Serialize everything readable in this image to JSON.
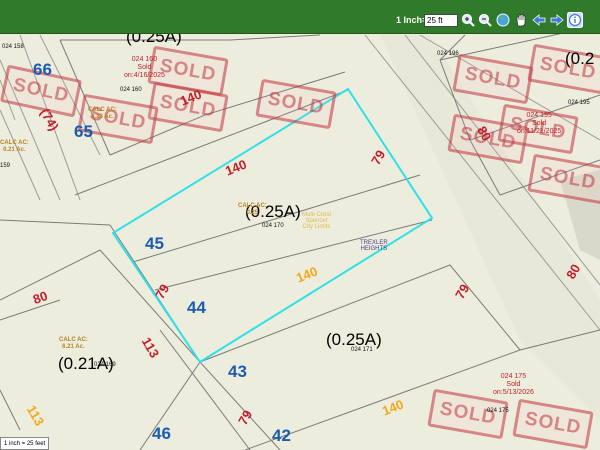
{
  "toolbar": {
    "scale_label": "1 Inch=",
    "scale_value": "25 ft",
    "tools": [
      "zoom-in",
      "zoom-out",
      "full-extent",
      "pan",
      "previous-extent",
      "next-extent",
      "identify"
    ]
  },
  "scale_note": "1 inch = 25 feet",
  "lots": [
    "66",
    "65",
    "45",
    "44",
    "43",
    "46",
    "42"
  ],
  "acres": [
    "(0.25A)",
    "(0.25A)",
    "(0.25A)",
    "(0.21A)",
    "(0.2"
  ],
  "dimensions_red": [
    "140",
    "140",
    "79",
    "79",
    "79",
    "80",
    "80",
    "79",
    "113",
    "(74)"
  ],
  "dimensions_orange": [
    "140",
    "140",
    "113"
  ],
  "parcels": {
    "p158": "024 158",
    "p160": "024 160",
    "p196": "024 196",
    "p195": "024 195",
    "p170": "024 170",
    "p171": "024 171",
    "p169": "024 169",
    "p175": "024 175",
    "p159": "159"
  },
  "calc_notes": [
    "CALC AC:\n0.23 Ac.",
    "CALC AC:\n0.21 Ac.",
    "CALC AC:\n6.21 Ac.",
    "CALC AC:\n0.25"
  ],
  "sold_notes": {
    "n160": "024 160\nSold\non:4/16/2025",
    "n195": "024 195\nSold\non:11/21/2025",
    "n175": "024 175\nSold\non:5/13/2026"
  },
  "map_text": {
    "subdivision": "TREXLER\nHEIGHTS",
    "city": "Mule Crest\nSpencer\nCity Limits"
  },
  "stamp_text": "SOLD",
  "colors": {
    "toolbar": "#2f7a2b",
    "selection": "#2fe0e8",
    "lot_number": "#1b5bb0",
    "dimension_red": "#c21f2a",
    "dimension_orange": "#f2a71a",
    "sold_stamp": "#c6414a"
  }
}
